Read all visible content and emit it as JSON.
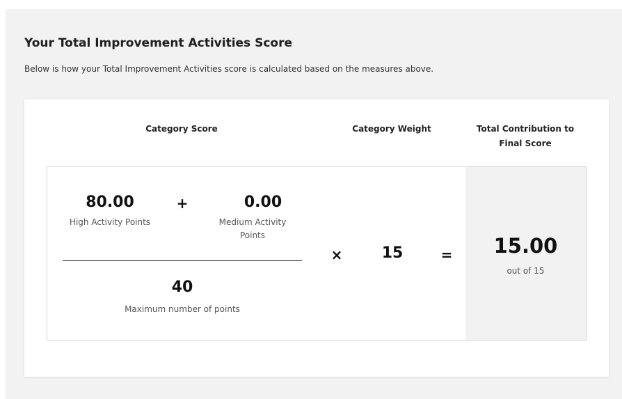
{
  "section": {
    "title": "Your Total Improvement Activities Score",
    "subtitle": "Below is how your Total Improvement Activities score is calculated based on the measures above."
  },
  "headers": {
    "category_score": "Category Score",
    "category_weight": "Category Weight",
    "total_contribution": "Total Contribution to Final Score"
  },
  "calculation": {
    "high_points_value": "80.00",
    "high_points_label": "High Activity Points",
    "plus_sign": "+",
    "medium_points_value": "0.00",
    "medium_points_label": "Medium Activity Points",
    "max_points_value": "40",
    "max_points_label": "Maximum number of points",
    "multiply_sign": "×",
    "weight_value": "15",
    "equals_sign": "=",
    "total_value": "15.00",
    "total_label": "out of 15"
  }
}
